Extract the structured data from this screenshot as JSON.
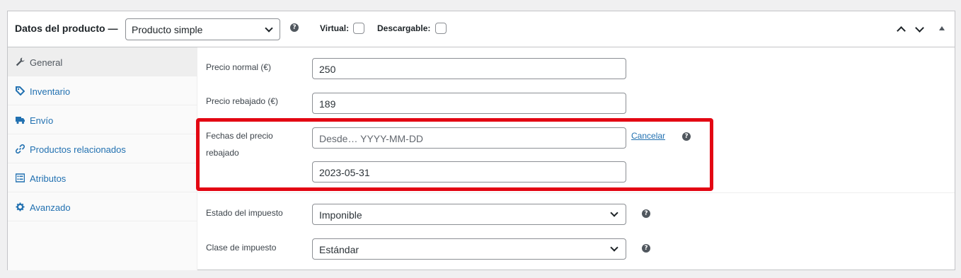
{
  "header": {
    "title": "Datos del producto —",
    "product_type": "Producto simple",
    "help_glyph": "?",
    "virtual_label": "Virtual:",
    "virtual_checked": false,
    "downloadable_label": "Descargable:",
    "downloadable_checked": false
  },
  "sidebar": {
    "tabs": [
      {
        "label": "General",
        "icon": "wrench-icon",
        "active": true
      },
      {
        "label": "Inventario",
        "icon": "tag-icon",
        "active": false
      },
      {
        "label": "Envío",
        "icon": "truck-icon",
        "active": false
      },
      {
        "label": "Productos relacionados",
        "icon": "link-icon",
        "active": false
      },
      {
        "label": "Atributos",
        "icon": "list-icon",
        "active": false
      },
      {
        "label": "Avanzado",
        "icon": "gear-icon",
        "active": false
      }
    ]
  },
  "fields": {
    "regular_price": {
      "label": "Precio normal (€)",
      "value": "250"
    },
    "sale_price": {
      "label": "Precio rebajado (€)",
      "value": "189"
    },
    "sale_dates": {
      "label_line1": "Fechas del precio",
      "label_line2": "rebajado",
      "from_placeholder": "Desde… YYYY-MM-DD",
      "to_value": "2023-05-31",
      "cancel_link": "Cancelar"
    },
    "tax_status": {
      "label": "Estado del impuesto",
      "value": "Imponible"
    },
    "tax_class": {
      "label": "Clase de impuesto",
      "value": "Estándar"
    }
  },
  "colors": {
    "highlight": "#e30613",
    "link": "#2271b1",
    "active_tab_bg": "#eeeeee"
  }
}
